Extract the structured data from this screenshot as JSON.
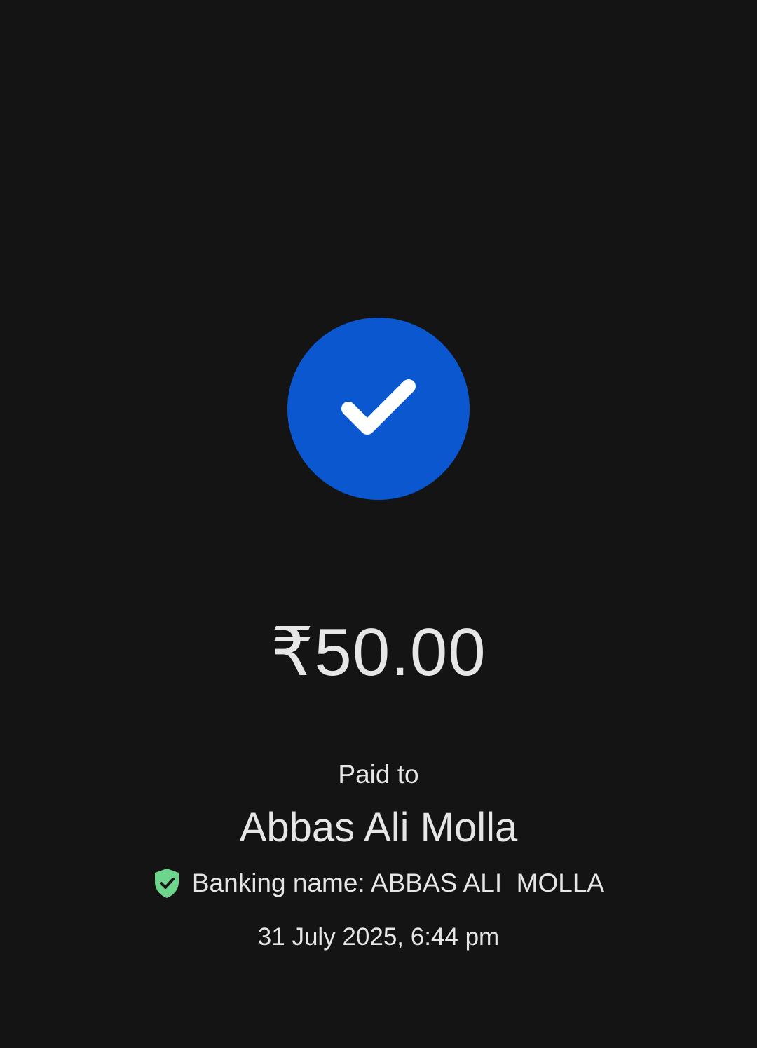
{
  "payment": {
    "status_icon": "checkmark-icon",
    "amount": "₹50.00",
    "paid_to_label": "Paid to",
    "payee_name": "Abbas Ali Molla",
    "verified_icon": "shield-check-icon",
    "banking_name": "Banking name: ABBAS ALI  MOLLA",
    "timestamp": "31 July 2025, 6:44 pm"
  },
  "colors": {
    "background": "#141414",
    "success_circle": "#0b57d0",
    "verified_shield": "#6dd58c",
    "text": "#e6e6e6"
  }
}
